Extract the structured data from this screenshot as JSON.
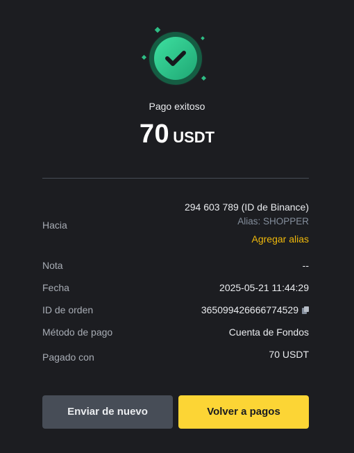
{
  "status": {
    "text": "Pago exitoso",
    "icon": "check-circle-icon",
    "accent_color": "#2ebd85"
  },
  "amount": {
    "value": "70",
    "unit": "USDT"
  },
  "details": {
    "to": {
      "label": "Hacia",
      "value": "294 603 789 (ID de Binance)",
      "alias": "Alias: SHOPPER",
      "add_alias": "Agregar alias"
    },
    "note": {
      "label": "Nota",
      "value": "--"
    },
    "date": {
      "label": "Fecha",
      "value": "2025-05-21 11:44:29"
    },
    "order_id": {
      "label": "ID de orden",
      "value": "365099426666774529",
      "icon": "copy-icon"
    },
    "payment_method": {
      "label": "Método de pago",
      "value": "Cuenta de Fondos"
    },
    "paid_with": {
      "label": "Pagado con",
      "value": "70 USDT"
    }
  },
  "actions": {
    "send_again": "Enviar de nuevo",
    "back_to_payments": "Volver a pagos"
  },
  "colors": {
    "background": "#1c1d21",
    "primary_button": "#fcd535",
    "secondary_button": "#474d57",
    "link": "#f0b90b"
  }
}
